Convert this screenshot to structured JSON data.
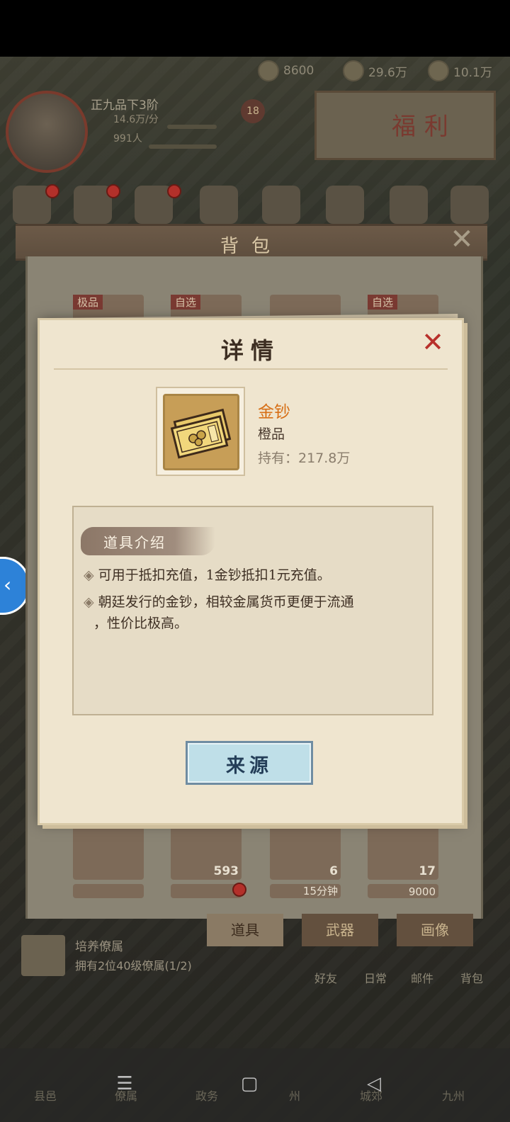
{
  "resources": [
    {
      "icon": "ingot-icon",
      "value": "8600"
    },
    {
      "icon": "coin-icon",
      "value": "29.6万"
    },
    {
      "icon": "food-icon",
      "value": "10.1万"
    }
  ],
  "player": {
    "rank": "正九品下3阶",
    "income": "14.6万/分",
    "people": "991人",
    "level": "18"
  },
  "welfare_label": "福利",
  "backpack": {
    "title": "背包",
    "close": "✕",
    "slot_tags": [
      "极品",
      "自选",
      "",
      "自选"
    ],
    "row3_counts": [
      "",
      "593",
      "6",
      "17"
    ],
    "row4_labels": [
      "",
      "",
      "15分钟",
      "9000"
    ],
    "tabs": [
      "道具",
      "武器",
      "画像"
    ]
  },
  "task": {
    "title": "培养僚属",
    "progress": "拥有2位40级僚属(1/2)"
  },
  "bottom_links": [
    "好友",
    "日常",
    "邮件",
    "背包"
  ],
  "nav_tabs": [
    "县邑",
    "僚属",
    "政务",
    "州",
    "城郊",
    "九州"
  ],
  "system_nav": {
    "menu": "☰",
    "home": "▢",
    "back": "◁"
  },
  "dialog": {
    "title": "详情",
    "close": "✕",
    "item": {
      "name": "金钞",
      "grade": "橙品",
      "holding": "持有：217.8万"
    },
    "desc_title": "道具介绍",
    "desc_lines": [
      "可用于抵扣充值，1金钞抵扣1元充值。",
      "朝廷发行的金钞，相较金属货币更便于流通",
      "，性价比极高。"
    ],
    "source_button": "来源"
  },
  "colors": {
    "item_name": "#d76f16",
    "close_x": "#b8302b",
    "source_button_bg": "#bfdfe8"
  }
}
